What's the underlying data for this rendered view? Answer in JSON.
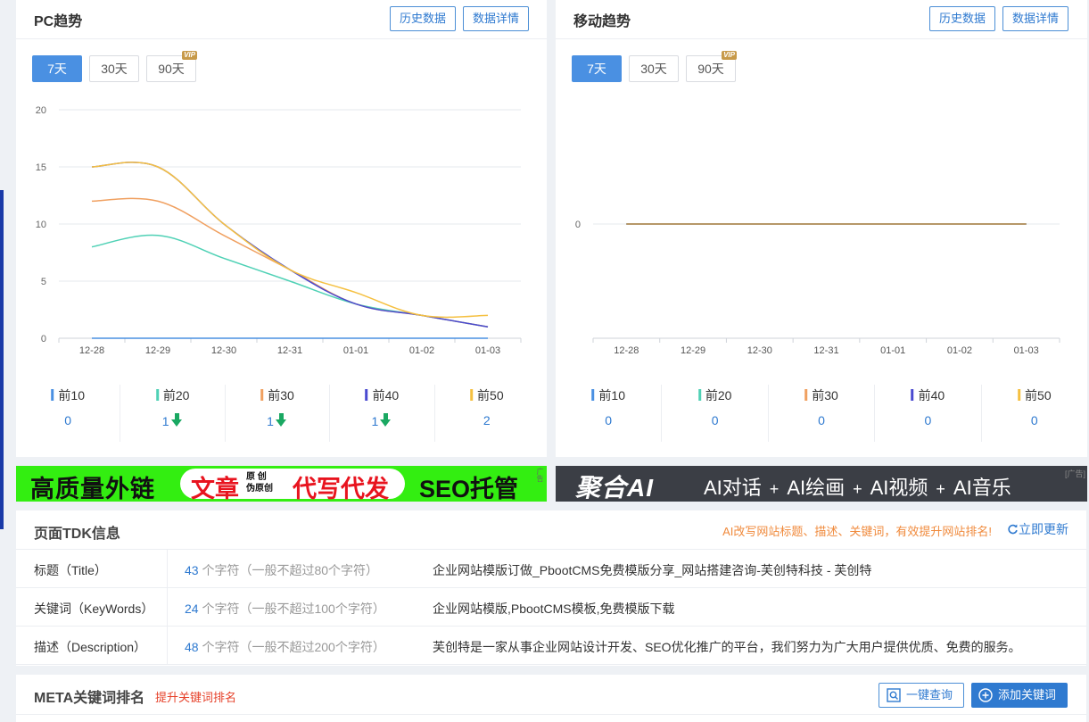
{
  "pc_panel": {
    "title": "PC趋势",
    "history_btn": "历史数据",
    "detail_btn": "数据详情",
    "ranges": [
      "7天",
      "30天",
      "90天"
    ],
    "vip_tag": "VIP",
    "legend": [
      {
        "label": "前10",
        "value": "0",
        "trend": "",
        "color": "#4a90e2"
      },
      {
        "label": "前20",
        "value": "1",
        "trend": "down",
        "color": "#4fd1b5"
      },
      {
        "label": "前30",
        "value": "1",
        "trend": "down",
        "color": "#f0a060"
      },
      {
        "label": "前40",
        "value": "1",
        "trend": "down",
        "color": "#4a4ad0"
      },
      {
        "label": "前50",
        "value": "2",
        "trend": "",
        "color": "#f5c040"
      }
    ]
  },
  "mobile_panel": {
    "title": "移动趋势",
    "history_btn": "历史数据",
    "detail_btn": "数据详情",
    "ranges": [
      "7天",
      "30天",
      "90天"
    ],
    "vip_tag": "VIP",
    "legend": [
      {
        "label": "前10",
        "value": "0",
        "trend": "",
        "color": "#4a90e2"
      },
      {
        "label": "前20",
        "value": "0",
        "trend": "",
        "color": "#4fd1b5"
      },
      {
        "label": "前30",
        "value": "0",
        "trend": "",
        "color": "#f0a060"
      },
      {
        "label": "前40",
        "value": "0",
        "trend": "",
        "color": "#4a4ad0"
      },
      {
        "label": "前50",
        "value": "0",
        "trend": "",
        "color": "#f5c040"
      }
    ]
  },
  "chart_data": [
    {
      "type": "line",
      "x": [
        "12-28",
        "12-29",
        "12-30",
        "12-31",
        "01-01",
        "01-02",
        "01-03"
      ],
      "ylim": [
        0,
        20
      ],
      "yticks": [
        0,
        5,
        10,
        15,
        20
      ],
      "grid": true,
      "series": [
        {
          "name": "前10",
          "color": "#4a90e2",
          "values": [
            0,
            0,
            0,
            0,
            0,
            0,
            0
          ]
        },
        {
          "name": "前20",
          "color": "#4fd1b5",
          "values": [
            8,
            9,
            7,
            5,
            3,
            2,
            1
          ]
        },
        {
          "name": "前30",
          "color": "#f0a060",
          "values": [
            12,
            12,
            9,
            6,
            3,
            2,
            1
          ]
        },
        {
          "name": "前40",
          "color": "#4a4ad0",
          "values": [
            15,
            15,
            10,
            6,
            3,
            2,
            1
          ]
        },
        {
          "name": "前50",
          "color": "#f5c040",
          "values": [
            15,
            15,
            10,
            6,
            4,
            2,
            2
          ]
        }
      ]
    },
    {
      "type": "line",
      "x": [
        "12-28",
        "12-29",
        "12-30",
        "12-31",
        "01-01",
        "01-02",
        "01-03"
      ],
      "yticks": [
        0
      ],
      "grid": true,
      "series": [
        {
          "name": "前10",
          "color": "#4a90e2",
          "values": [
            0,
            0,
            0,
            0,
            0,
            0,
            0
          ]
        },
        {
          "name": "前20",
          "color": "#4fd1b5",
          "values": [
            0,
            0,
            0,
            0,
            0,
            0,
            0
          ]
        },
        {
          "name": "前30",
          "color": "#f0a060",
          "values": [
            0,
            0,
            0,
            0,
            0,
            0,
            0
          ]
        },
        {
          "name": "前40",
          "color": "#4a4ad0",
          "values": [
            0,
            0,
            0,
            0,
            0,
            0,
            0
          ]
        },
        {
          "name": "前50",
          "color": "#c8a050",
          "values": [
            0,
            0,
            0,
            0,
            0,
            0,
            0
          ]
        }
      ]
    }
  ],
  "ads": {
    "left": {
      "text1": "高质量外链",
      "text2": "文章",
      "small1": "原 创",
      "small2": "伪原创",
      "text3": "代写代发",
      "text4": "SEO托管",
      "tag": "广告"
    },
    "right": {
      "brand": "聚合AI",
      "items": [
        "AI对话",
        "+",
        "AI绘画",
        "+",
        "AI视频",
        "+",
        "AI音乐"
      ],
      "tag": "[广告]"
    }
  },
  "tdk": {
    "title": "页面TDK信息",
    "promo": "AI改写网站标题、描述、关键词，有效提升网站排名!",
    "refresh": "立即更新",
    "rows": [
      {
        "label": "标题（Title）",
        "count": "43",
        "count_suffix": " 个字符（一般不超过80个字符）",
        "content": "企业网站模版订做_PbootCMS免费模版分享_网站搭建咨询-芙创特科技 - 芙创特"
      },
      {
        "label": "关键词（KeyWords）",
        "count": "24",
        "count_suffix": " 个字符（一般不超过100个字符）",
        "content": "企业网站模版,PbootCMS模板,免费模版下载"
      },
      {
        "label": "描述（Description）",
        "count": "48",
        "count_suffix": " 个字符（一般不超过200个字符）",
        "content": "芙创特是一家从事企业网站设计开发、SEO优化推广的平台，我们努力为广大用户提供优质、免费的服务。"
      }
    ]
  },
  "meta": {
    "title": "META关键词排名",
    "subtitle": "提升关键词排名",
    "query_btn": "一键查询",
    "add_btn": "添加关键词"
  }
}
